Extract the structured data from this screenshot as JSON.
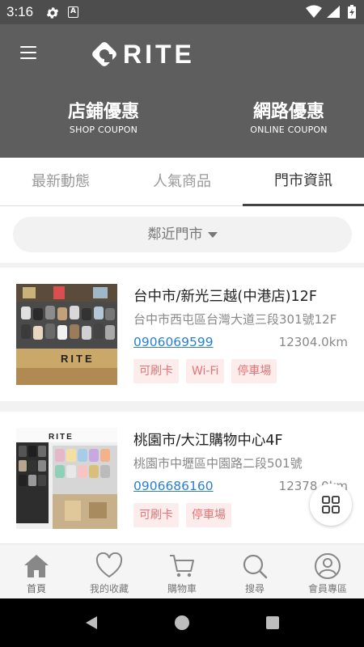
{
  "status_bar": {
    "time": "3:16",
    "icons": [
      "gear-icon",
      "a-notification-icon",
      "wifi-icon",
      "signal-icon",
      "battery-charging-icon"
    ]
  },
  "header": {
    "brand": "RITE",
    "coupons": [
      {
        "title": "店鋪優惠",
        "subtitle": "SHOP COUPON"
      },
      {
        "title": "網路優惠",
        "subtitle": "ONLINE COUPON"
      }
    ]
  },
  "tabs": [
    {
      "label": "最新動態",
      "active": false
    },
    {
      "label": "人氣商品",
      "active": false
    },
    {
      "label": "門市資訊",
      "active": true
    }
  ],
  "filter": {
    "label": "鄰近門市"
  },
  "stores": [
    {
      "name": "台中市/新光三越(中港店)12F",
      "address": "台中市西屯區台灣大道三段301號12F",
      "phone": "0906069599",
      "distance": "12304.0km",
      "tags": [
        "可刷卡",
        "Wi-Fi",
        "停車場"
      ]
    },
    {
      "name": "桃園市/大江購物中心4F",
      "address": "桃園市中壢區中園路二段501號",
      "phone": "0906686160",
      "distance": "12378.0km",
      "tags": [
        "可刷卡",
        "停車場"
      ]
    }
  ],
  "bottom_nav": [
    {
      "label": "首頁",
      "icon": "home-icon"
    },
    {
      "label": "我的收藏",
      "icon": "heart-icon"
    },
    {
      "label": "購物車",
      "icon": "cart-icon"
    },
    {
      "label": "搜尋",
      "icon": "search-icon"
    },
    {
      "label": "會員專區",
      "icon": "user-icon"
    }
  ],
  "colors": {
    "header_bg": "#5e5e5e",
    "status_bg": "#4d4d4d",
    "link_blue": "#2a7fd4",
    "tag_bg": "#fdecec",
    "tag_text": "#e57373"
  }
}
